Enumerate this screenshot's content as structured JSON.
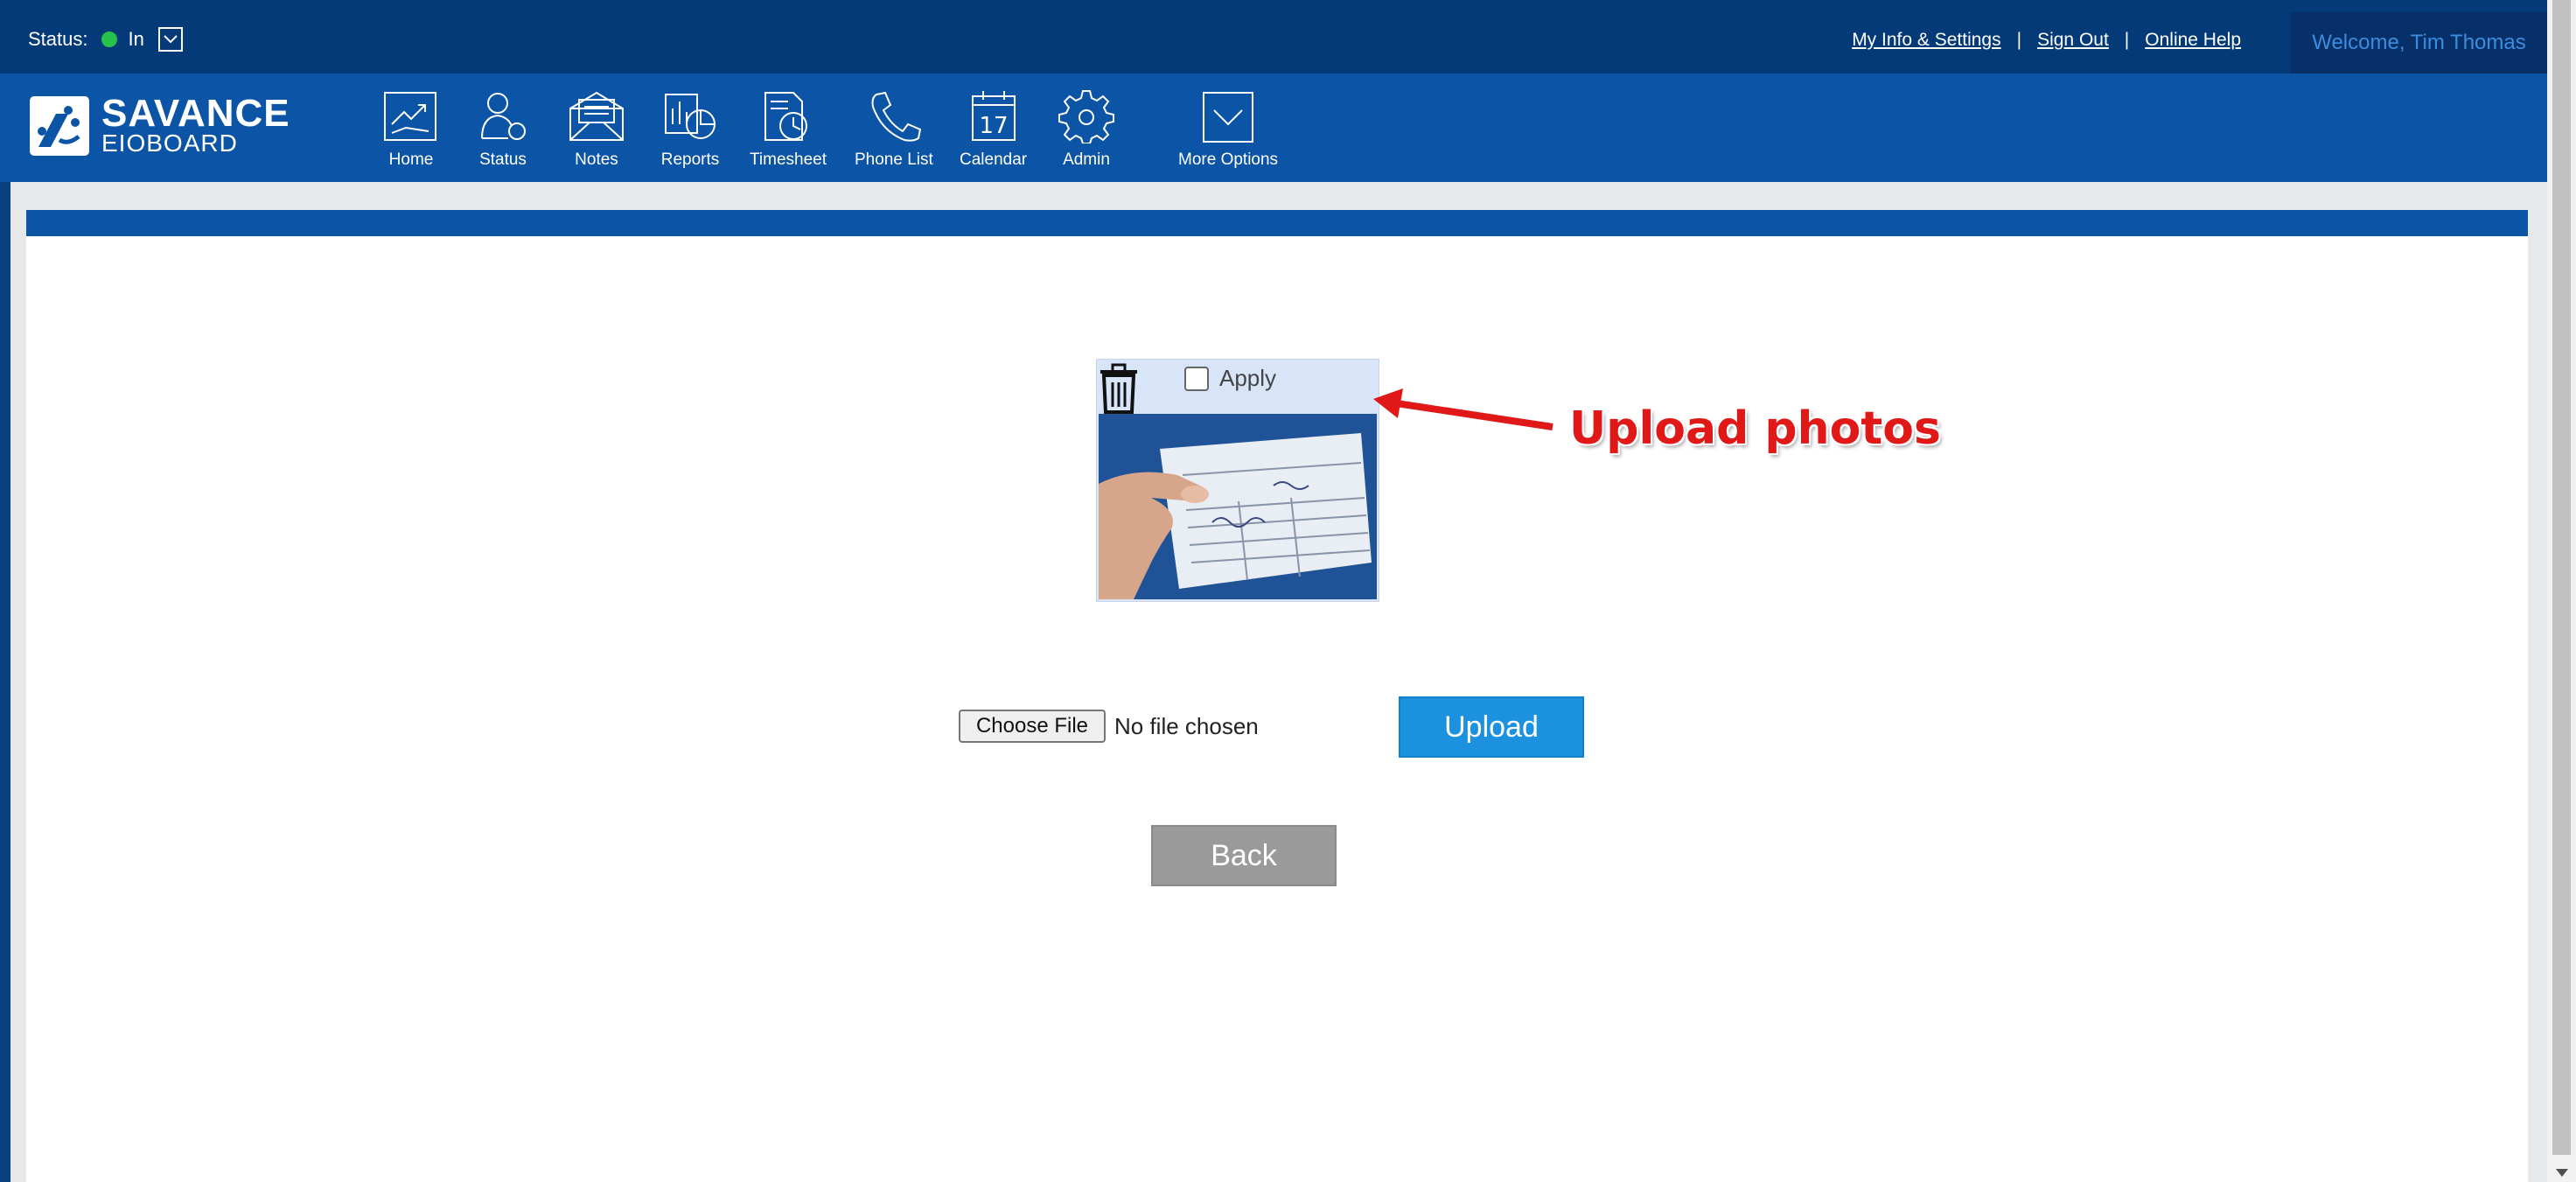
{
  "topbar": {
    "status_label": "Status:",
    "status_value": "In",
    "status_color": "#27c24c",
    "links": [
      "My Info & Settings",
      "Sign Out",
      "Online Help"
    ],
    "separator": "|",
    "welcome": "Welcome, Tim Thomas"
  },
  "brand": {
    "name_line1": "SAVANCE",
    "name_line2": "EIOBOARD",
    "primary_color": "#0c54a6"
  },
  "nav": {
    "items": [
      {
        "label": "Home",
        "icon": "home-icon"
      },
      {
        "label": "Status",
        "icon": "status-icon"
      },
      {
        "label": "Notes",
        "icon": "notes-icon"
      },
      {
        "label": "Reports",
        "icon": "reports-icon"
      },
      {
        "label": "Timesheet",
        "icon": "timesheet-icon"
      },
      {
        "label": "Phone List",
        "icon": "phone-icon"
      },
      {
        "label": "Calendar",
        "icon": "calendar-icon",
        "icon_text": "17"
      },
      {
        "label": "Admin",
        "icon": "gear-icon"
      },
      {
        "label": "More Options",
        "icon": "chevron-down-icon"
      }
    ]
  },
  "photo_card": {
    "apply_label": "Apply",
    "apply_checked": false
  },
  "annotation": {
    "text": "Upload photos",
    "color": "#e01818"
  },
  "upload_form": {
    "choose_file_label": "Choose File",
    "file_status": "No file chosen",
    "upload_label": "Upload",
    "back_label": "Back"
  }
}
